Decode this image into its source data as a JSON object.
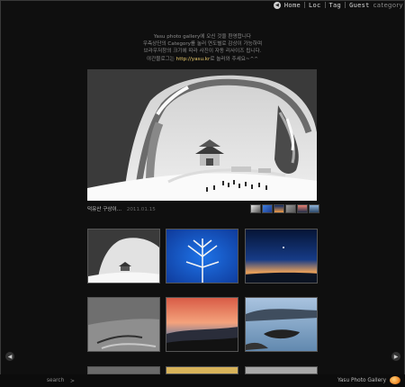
{
  "topnav": {
    "home": "Home",
    "loc": "Loc",
    "tag": "Tag",
    "guest": "Guest",
    "category": "category"
  },
  "intro": {
    "line1": "Yasu  photo gallery에 오신 것을 환영합니다",
    "line2": "우측상단의 Category를 눌러 연도별로 감상이 가능하며",
    "line3": "브라우저창의 크기에 따라 사진이 자동 리사이즈 됩니다.",
    "line4_prefix": "야간블로그는 ",
    "link": "http://yasu.kr",
    "line4_suffix": "로 놀러와 주세요~^^"
  },
  "featured": {
    "title": "덕유산 구상이...",
    "date": "2011.01.15"
  },
  "footer": {
    "search_label": "search",
    "search_arrow": ">",
    "brand": "Yasu Photo Gallery"
  }
}
